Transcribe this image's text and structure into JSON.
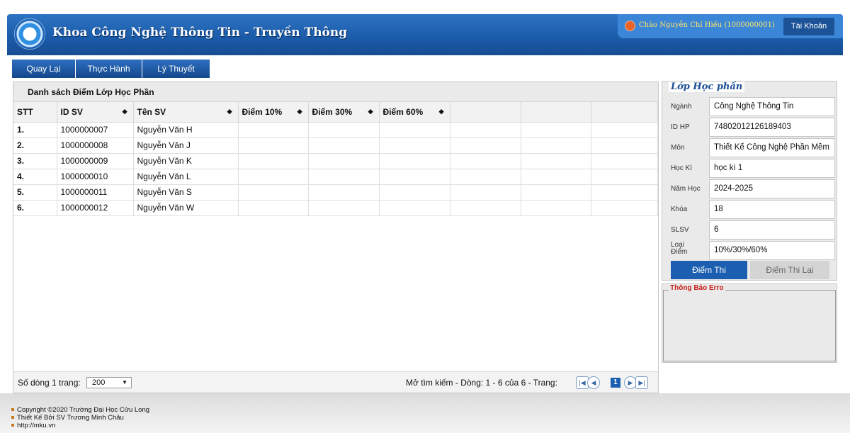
{
  "header": {
    "title": "Khoa Công Nghệ Thông Tin - Truyền Thông",
    "greeting": "Chào Nguyễn Chí Hiếu (1000000001)",
    "account_label": "Tài Khoản"
  },
  "nav": [
    {
      "label": "Quay Lại"
    },
    {
      "label": "Thực Hành"
    },
    {
      "label": "Lý Thuyết"
    }
  ],
  "grade_table": {
    "caption": "Danh sách Điểm Lớp Học Phần",
    "columns": [
      "STT",
      "ID SV",
      "Tên SV",
      "Điểm 10%",
      "Điểm 30%",
      "Điểm 60%"
    ],
    "rows": [
      {
        "stt": "1.",
        "id": "1000000007",
        "name": "Nguyễn Văn H"
      },
      {
        "stt": "2.",
        "id": "1000000008",
        "name": "Nguyễn Văn J"
      },
      {
        "stt": "3.",
        "id": "1000000009",
        "name": "Nguyễn Văn K"
      },
      {
        "stt": "4.",
        "id": "1000000010",
        "name": "Nguyễn Văn L"
      },
      {
        "stt": "5.",
        "id": "1000000011",
        "name": "Nguyễn Văn S"
      },
      {
        "stt": "6.",
        "id": "1000000012",
        "name": "Nguyễn Văn W"
      }
    ],
    "pager": {
      "rows_per_page_label": "Số dòng 1 trang:",
      "rows_per_page_value": "200",
      "info": "Mở tìm kiếm   -   Dòng: 1 - 6 của 6 - Trang:",
      "current_page": "1"
    }
  },
  "course_panel": {
    "title": "Lớp Học phần",
    "fields": [
      {
        "label": "Ngành",
        "value": "Công Nghệ Thông Tin"
      },
      {
        "label": "ID HP",
        "value": "74802012126189403"
      },
      {
        "label": "Môn",
        "value": "Thiết Kế Công Nghệ Phần Mềm"
      },
      {
        "label": "Học Kì",
        "value": "học kì 1"
      },
      {
        "label": "Năm Học",
        "value": "2024-2025"
      },
      {
        "label": "Khóa",
        "value": "18"
      },
      {
        "label": "SLSV",
        "value": "6"
      },
      {
        "label": "Loại Điểm",
        "value": "10%/30%/60%"
      }
    ],
    "exam_tab": "Điểm Thi",
    "retake_tab": "Điểm Thi Lại"
  },
  "error_panel": {
    "title": "Thông Báo Erro"
  },
  "footer": {
    "copyright": "Copyright ©2020 Trường Đại Học Cửu Long",
    "designer": "Thiết Kế Bởi SV Trương Minh Châu",
    "url": "http://mku.vn"
  },
  "colors": {
    "header_blue": "#1a5aa8",
    "nav_blue": "#14478c",
    "greeting_yellow": "#ffe66a",
    "error_red": "#c8201a",
    "active_tab": "#1c5fb0"
  }
}
